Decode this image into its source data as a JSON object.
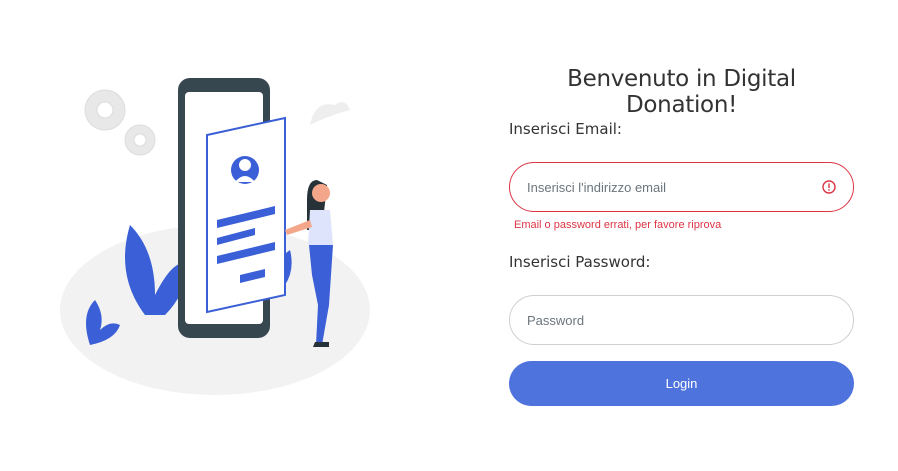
{
  "title": "Benvenuto in Digital Donation!",
  "email": {
    "label": "Inserisci Email:",
    "placeholder": "Inserisci l'indirizzo email",
    "value": "",
    "error_icon": "alert-circle-icon",
    "error_message": "Email o password errati, per favore riprova"
  },
  "password": {
    "label": "Inserisci Password:",
    "placeholder": "Password",
    "value": ""
  },
  "login_button": {
    "label": "Login"
  },
  "colors": {
    "accent": "#4f73dd",
    "error": "#dc3545",
    "illustration_blue": "#3a5fd6",
    "illustration_dark": "#37474f"
  }
}
